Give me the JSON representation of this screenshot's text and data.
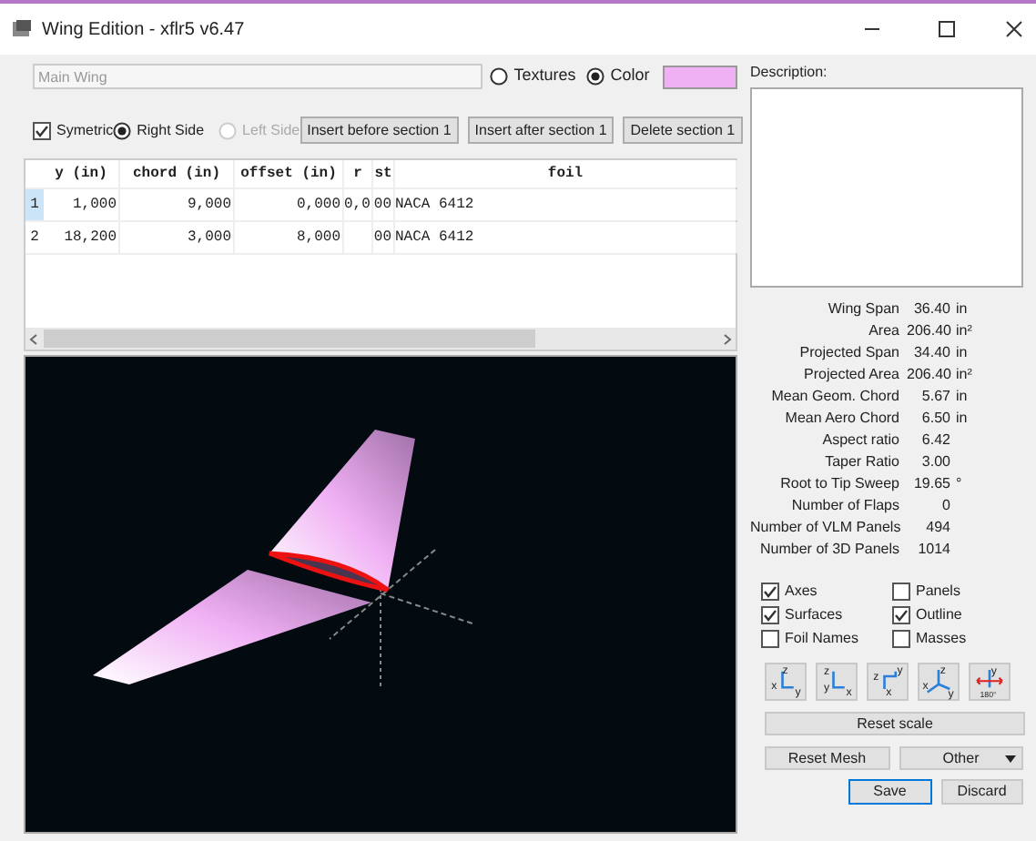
{
  "window": {
    "title": "Wing Edition - xflr5 v6.47"
  },
  "wing_name": {
    "value": "Main Wing"
  },
  "appearance": {
    "options": [
      {
        "label": "Textures",
        "selected": false
      },
      {
        "label": "Color",
        "selected": true
      }
    ],
    "color": "#f0b0f4"
  },
  "symmetric": {
    "label": "Symetric",
    "checked": true
  },
  "sides": [
    {
      "label": "Right Side",
      "selected": true,
      "disabled": false
    },
    {
      "label": "Left Side",
      "selected": false,
      "disabled": true
    }
  ],
  "section_buttons": [
    "Insert before section 1",
    "Insert after section 1",
    "Delete section 1"
  ],
  "table": {
    "columns": [
      "y (in)",
      "chord (in)",
      "offset (in)",
      "r",
      "st",
      "foil"
    ],
    "rows": [
      {
        "index": "1",
        "selected": true,
        "cells": [
          "1,000",
          "9,000",
          "0,000",
          "0,0",
          "00",
          "NACA 6412"
        ]
      },
      {
        "index": "2",
        "selected": false,
        "cells": [
          "18,200",
          "3,000",
          "8,000",
          "",
          "00",
          "NACA 6412"
        ]
      }
    ]
  },
  "description": {
    "label": "Description:"
  },
  "stats": [
    {
      "label": "Wing Span",
      "value": "36.40",
      "unit": "in"
    },
    {
      "label": "Area",
      "value": "206.40",
      "unit": "in²"
    },
    {
      "label": "Projected Span",
      "value": "34.40",
      "unit": "in"
    },
    {
      "label": "Projected Area",
      "value": "206.40",
      "unit": "in²"
    },
    {
      "label": "Mean Geom. Chord",
      "value": "5.67",
      "unit": "in"
    },
    {
      "label": "Mean Aero Chord",
      "value": "6.50",
      "unit": "in"
    },
    {
      "label": "Aspect ratio",
      "value": "6.42"
    },
    {
      "label": "Taper Ratio",
      "value": "3.00"
    },
    {
      "label": "Root to Tip Sweep",
      "value": "19.65",
      "unit": "°"
    },
    {
      "label": "Number of Flaps",
      "value": "0"
    },
    {
      "label": "Number of VLM Panels",
      "value": "494"
    },
    {
      "label": "Number of 3D Panels",
      "value": "1014"
    }
  ],
  "display_options": [
    {
      "label": "Axes",
      "checked": true
    },
    {
      "label": "Panels",
      "checked": false
    },
    {
      "label": "Surfaces",
      "checked": true
    },
    {
      "label": "Outline",
      "checked": true
    },
    {
      "label": "Foil Names",
      "checked": false
    },
    {
      "label": "Masses",
      "checked": false
    }
  ],
  "view_buttons": [
    {
      "kind": "front",
      "labels": [
        "z",
        "x",
        "y"
      ]
    },
    {
      "kind": "side",
      "labels": [
        "z",
        "y",
        "x"
      ]
    },
    {
      "kind": "top",
      "labels": [
        "y",
        "z",
        "x"
      ]
    },
    {
      "kind": "iso",
      "labels": [
        "z",
        "x",
        "y"
      ]
    },
    {
      "kind": "flip",
      "labels": [
        "y",
        "180°"
      ]
    }
  ],
  "reset_scale": "Reset scale",
  "reset_mesh": "Reset Mesh",
  "other": "Other",
  "actions": [
    {
      "label": "Save",
      "default": true
    },
    {
      "label": "Discard",
      "default": false
    }
  ]
}
